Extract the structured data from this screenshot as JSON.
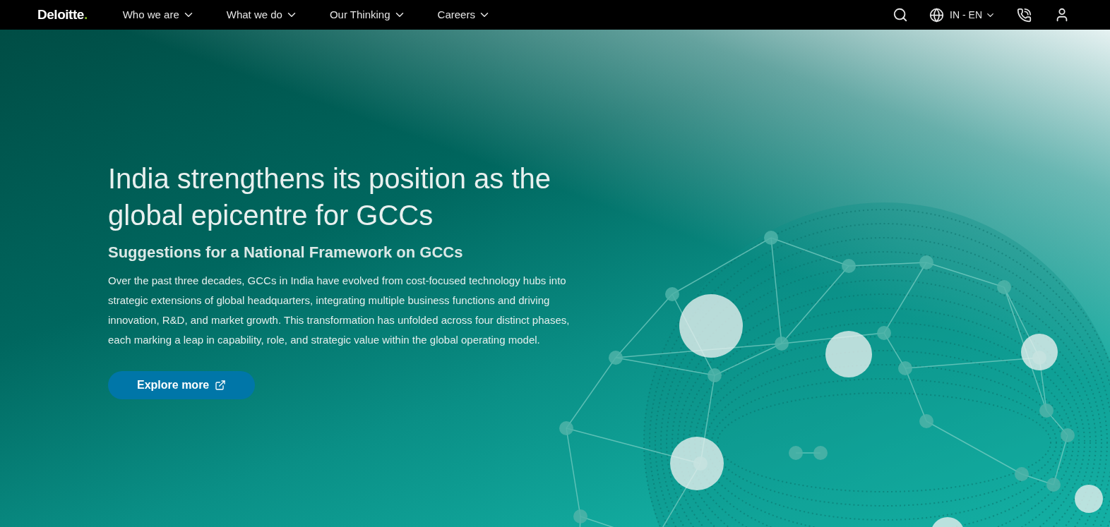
{
  "nav": {
    "logo": {
      "text": "Deloitte",
      "dot": "."
    },
    "items": [
      {
        "label": "Who we are"
      },
      {
        "label": "What we do"
      },
      {
        "label": "Our Thinking"
      },
      {
        "label": "Careers"
      }
    ],
    "locale": "IN - EN"
  },
  "hero": {
    "title": "India strengthens its position as the global epicentre for GCCs",
    "subtitle": "Suggestions for a National Framework on GCCs",
    "body": "Over the past three decades, GCCs in India have evolved from cost-focused technology hubs into strategic extensions of global headquarters, integrating multiple business functions and driving innovation, R&D, and market growth. This transformation has unfolded across four distinct phases, each marking a leap in capability, role, and strategic value within the global operating model.",
    "button": "Explore more"
  }
}
